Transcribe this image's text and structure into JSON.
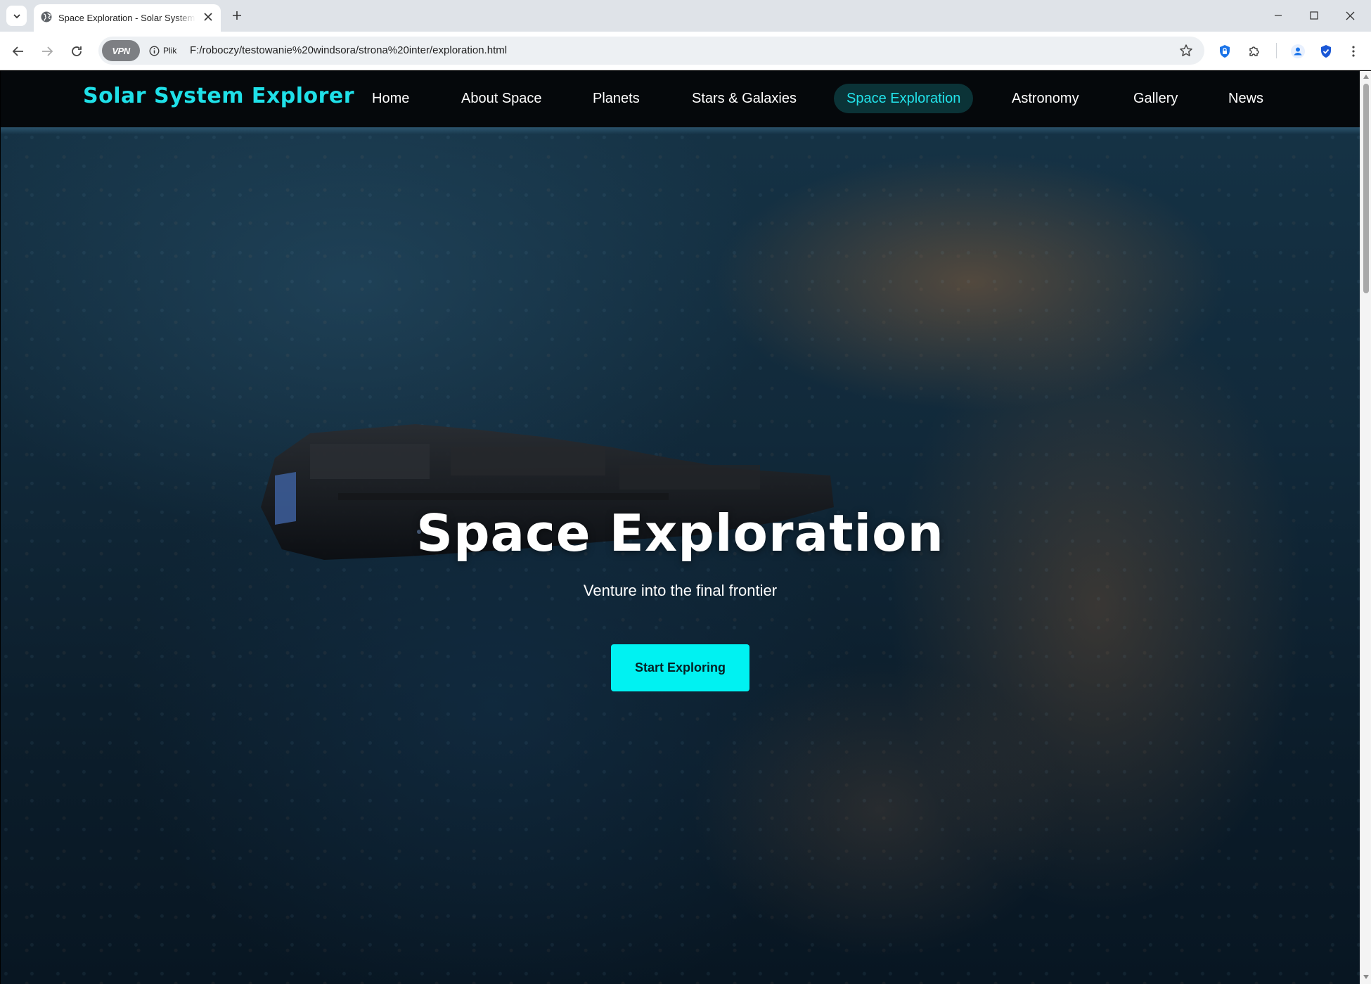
{
  "browser": {
    "tab_title": "Space Exploration - Solar System Explorer",
    "url": "F:/roboczy/testowanie%20windsora/strona%20inter/exploration.html",
    "vpn_label": "VPN",
    "site_info_label": "Plik"
  },
  "site": {
    "brand": "Solar System Explorer",
    "nav": [
      {
        "label": "Home",
        "active": false
      },
      {
        "label": "About Space",
        "active": false
      },
      {
        "label": "Planets",
        "active": false
      },
      {
        "label": "Stars & Galaxies",
        "active": false
      },
      {
        "label": "Space Exploration",
        "active": true
      },
      {
        "label": "Astronomy",
        "active": false
      },
      {
        "label": "Gallery",
        "active": false
      },
      {
        "label": "News",
        "active": false
      }
    ]
  },
  "hero": {
    "title": "Space Exploration",
    "subtitle": "Venture into the final frontier",
    "cta_label": "Start Exploring"
  },
  "colors": {
    "accent": "#00f2f2",
    "brand": "#1fe0e8",
    "nav_background": "#05080b",
    "active_nav_background": "#0b3337"
  }
}
